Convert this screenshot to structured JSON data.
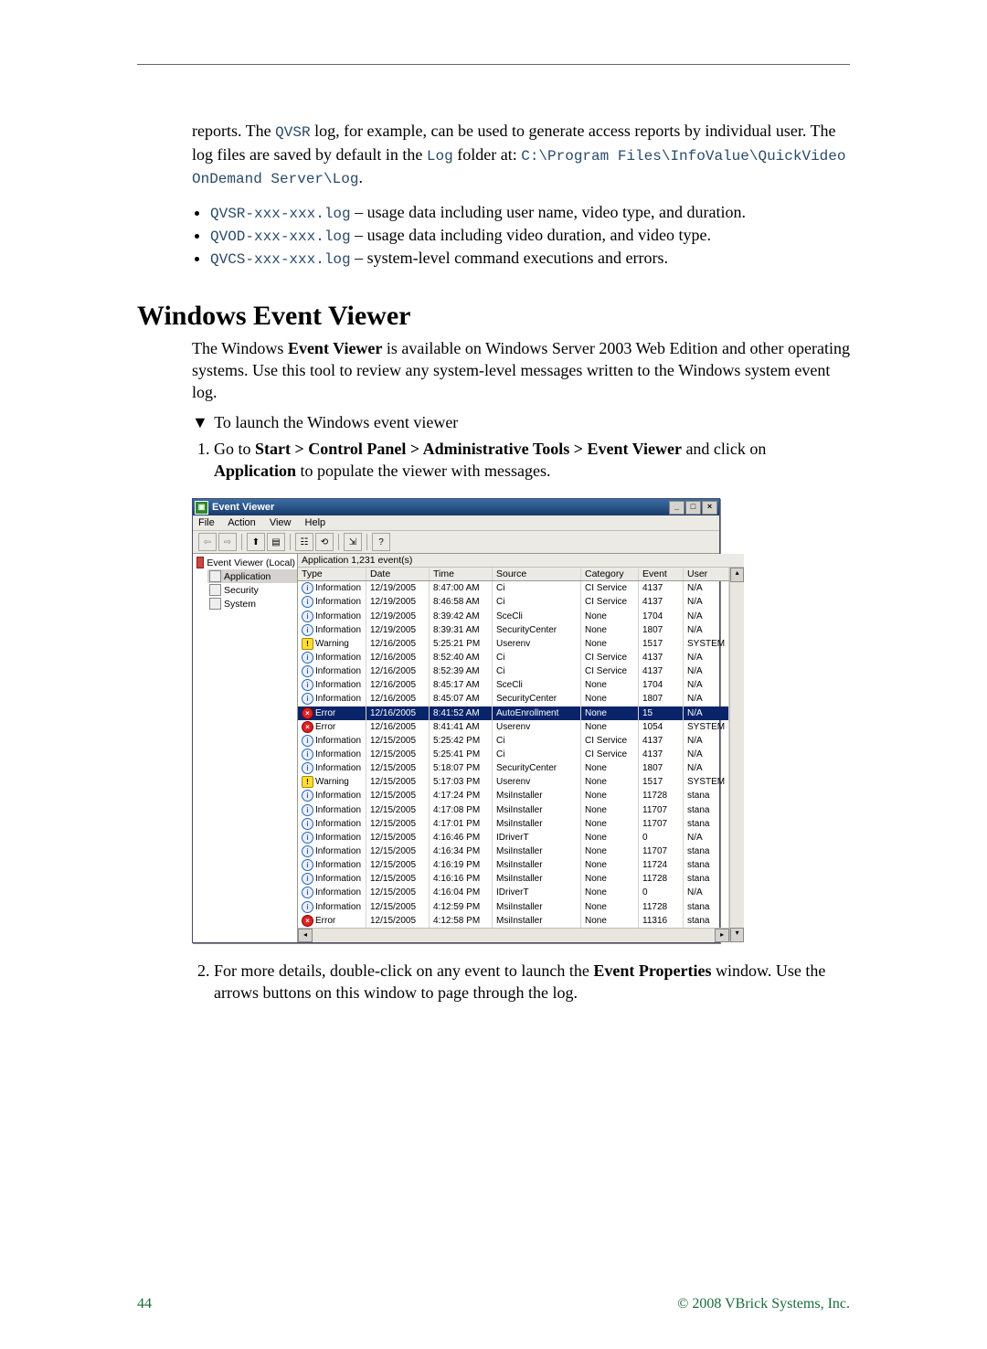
{
  "intro": {
    "p1a": "reports. The ",
    "code1": "QVSR",
    "p1b": " log, for example, can be used to generate access reports by individual user. The log files are saved by default in the ",
    "code2": "Log",
    "p1c": " folder at: ",
    "code3": "C:\\Program Files\\InfoValue\\QuickVideo OnDemand Server\\Log",
    "p1d": "."
  },
  "logs": [
    {
      "file": "QVSR-xxx-xxx.log",
      "desc": " – usage data including user name, video type, and duration."
    },
    {
      "file": "QVOD-xxx-xxx.log",
      "desc": " – usage data including video duration, and video type."
    },
    {
      "file": "QVCS-xxx-xxx.log",
      "desc": " – system-level command executions and errors."
    }
  ],
  "section_title": "Windows Event Viewer",
  "para2a": "The Windows ",
  "para2bold": "Event Viewer",
  "para2b": " is available on Windows Server 2003 Web Edition and other operating systems. Use this tool to review any system-level messages written to the Windows system event log.",
  "launch_line": "To launch the Windows event viewer",
  "step1a": "Go to ",
  "step1bold": "Start > Control Panel > Administrative Tools > Event Viewer",
  "step1b": " and click on ",
  "step1bold2": "Application",
  "step1c": " to populate the viewer with messages.",
  "step2a": "For more details, double-click on any event to launch the ",
  "step2bold": "Event Properties",
  "step2b": " window. Use the arrows buttons on this window to page through the log.",
  "ev": {
    "title": "Event Viewer",
    "menu": [
      "File",
      "Action",
      "View",
      "Help"
    ],
    "tree_root": "Event Viewer (Local)",
    "tree": [
      "Application",
      "Security",
      "System"
    ],
    "list_header": "Application   1,231 event(s)",
    "cols": [
      "Type",
      "Date",
      "Time",
      "Source",
      "Category",
      "Event",
      "User"
    ],
    "rows": [
      {
        "t": "Information",
        "i": "info",
        "d": "12/19/2005",
        "tm": "8:47:00 AM",
        "s": "Ci",
        "c": "CI Service",
        "e": "4137",
        "u": "N/A"
      },
      {
        "t": "Information",
        "i": "info",
        "d": "12/19/2005",
        "tm": "8:46:58 AM",
        "s": "Ci",
        "c": "CI Service",
        "e": "4137",
        "u": "N/A"
      },
      {
        "t": "Information",
        "i": "info",
        "d": "12/19/2005",
        "tm": "8:39:42 AM",
        "s": "SceCli",
        "c": "None",
        "e": "1704",
        "u": "N/A"
      },
      {
        "t": "Information",
        "i": "info",
        "d": "12/19/2005",
        "tm": "8:39:31 AM",
        "s": "SecurityCenter",
        "c": "None",
        "e": "1807",
        "u": "N/A"
      },
      {
        "t": "Warning",
        "i": "warn",
        "d": "12/16/2005",
        "tm": "5:25:21 PM",
        "s": "Userenv",
        "c": "None",
        "e": "1517",
        "u": "SYSTEM"
      },
      {
        "t": "Information",
        "i": "info",
        "d": "12/16/2005",
        "tm": "8:52:40 AM",
        "s": "Ci",
        "c": "CI Service",
        "e": "4137",
        "u": "N/A"
      },
      {
        "t": "Information",
        "i": "info",
        "d": "12/16/2005",
        "tm": "8:52:39 AM",
        "s": "Ci",
        "c": "CI Service",
        "e": "4137",
        "u": "N/A"
      },
      {
        "t": "Information",
        "i": "info",
        "d": "12/16/2005",
        "tm": "8:45:17 AM",
        "s": "SceCli",
        "c": "None",
        "e": "1704",
        "u": "N/A"
      },
      {
        "t": "Information",
        "i": "info",
        "d": "12/16/2005",
        "tm": "8:45:07 AM",
        "s": "SecurityCenter",
        "c": "None",
        "e": "1807",
        "u": "N/A"
      },
      {
        "t": "Error",
        "i": "err",
        "d": "12/16/2005",
        "tm": "8:41:52 AM",
        "s": "AutoEnrollment",
        "c": "None",
        "e": "15",
        "u": "N/A",
        "sel": true
      },
      {
        "t": "Error",
        "i": "err",
        "d": "12/16/2005",
        "tm": "8:41:41 AM",
        "s": "Userenv",
        "c": "None",
        "e": "1054",
        "u": "SYSTEM"
      },
      {
        "t": "Information",
        "i": "info",
        "d": "12/15/2005",
        "tm": "5:25:42 PM",
        "s": "Ci",
        "c": "CI Service",
        "e": "4137",
        "u": "N/A"
      },
      {
        "t": "Information",
        "i": "info",
        "d": "12/15/2005",
        "tm": "5:25:41 PM",
        "s": "Ci",
        "c": "CI Service",
        "e": "4137",
        "u": "N/A"
      },
      {
        "t": "Information",
        "i": "info",
        "d": "12/15/2005",
        "tm": "5:18:07 PM",
        "s": "SecurityCenter",
        "c": "None",
        "e": "1807",
        "u": "N/A"
      },
      {
        "t": "Warning",
        "i": "warn",
        "d": "12/15/2005",
        "tm": "5:17:03 PM",
        "s": "Userenv",
        "c": "None",
        "e": "1517",
        "u": "SYSTEM"
      },
      {
        "t": "Information",
        "i": "info",
        "d": "12/15/2005",
        "tm": "4:17:24 PM",
        "s": "MsiInstaller",
        "c": "None",
        "e": "11728",
        "u": "stana"
      },
      {
        "t": "Information",
        "i": "info",
        "d": "12/15/2005",
        "tm": "4:17:08 PM",
        "s": "MsiInstaller",
        "c": "None",
        "e": "11707",
        "u": "stana"
      },
      {
        "t": "Information",
        "i": "info",
        "d": "12/15/2005",
        "tm": "4:17:01 PM",
        "s": "MsiInstaller",
        "c": "None",
        "e": "11707",
        "u": "stana"
      },
      {
        "t": "Information",
        "i": "info",
        "d": "12/15/2005",
        "tm": "4:16:46 PM",
        "s": "IDriverT",
        "c": "None",
        "e": "0",
        "u": "N/A"
      },
      {
        "t": "Information",
        "i": "info",
        "d": "12/15/2005",
        "tm": "4:16:34 PM",
        "s": "MsiInstaller",
        "c": "None",
        "e": "11707",
        "u": "stana"
      },
      {
        "t": "Information",
        "i": "info",
        "d": "12/15/2005",
        "tm": "4:16:19 PM",
        "s": "MsiInstaller",
        "c": "None",
        "e": "11724",
        "u": "stana"
      },
      {
        "t": "Information",
        "i": "info",
        "d": "12/15/2005",
        "tm": "4:16:16 PM",
        "s": "MsiInstaller",
        "c": "None",
        "e": "11728",
        "u": "stana"
      },
      {
        "t": "Information",
        "i": "info",
        "d": "12/15/2005",
        "tm": "4:16:04 PM",
        "s": "IDriverT",
        "c": "None",
        "e": "0",
        "u": "N/A"
      },
      {
        "t": "Information",
        "i": "info",
        "d": "12/15/2005",
        "tm": "4:12:59 PM",
        "s": "MsiInstaller",
        "c": "None",
        "e": "11728",
        "u": "stana"
      },
      {
        "t": "Error",
        "i": "err",
        "d": "12/15/2005",
        "tm": "4:12:58 PM",
        "s": "MsiInstaller",
        "c": "None",
        "e": "11316",
        "u": "stana"
      }
    ]
  },
  "footer_page": "44",
  "footer_copy": "© 2008 VBrick Systems, Inc."
}
